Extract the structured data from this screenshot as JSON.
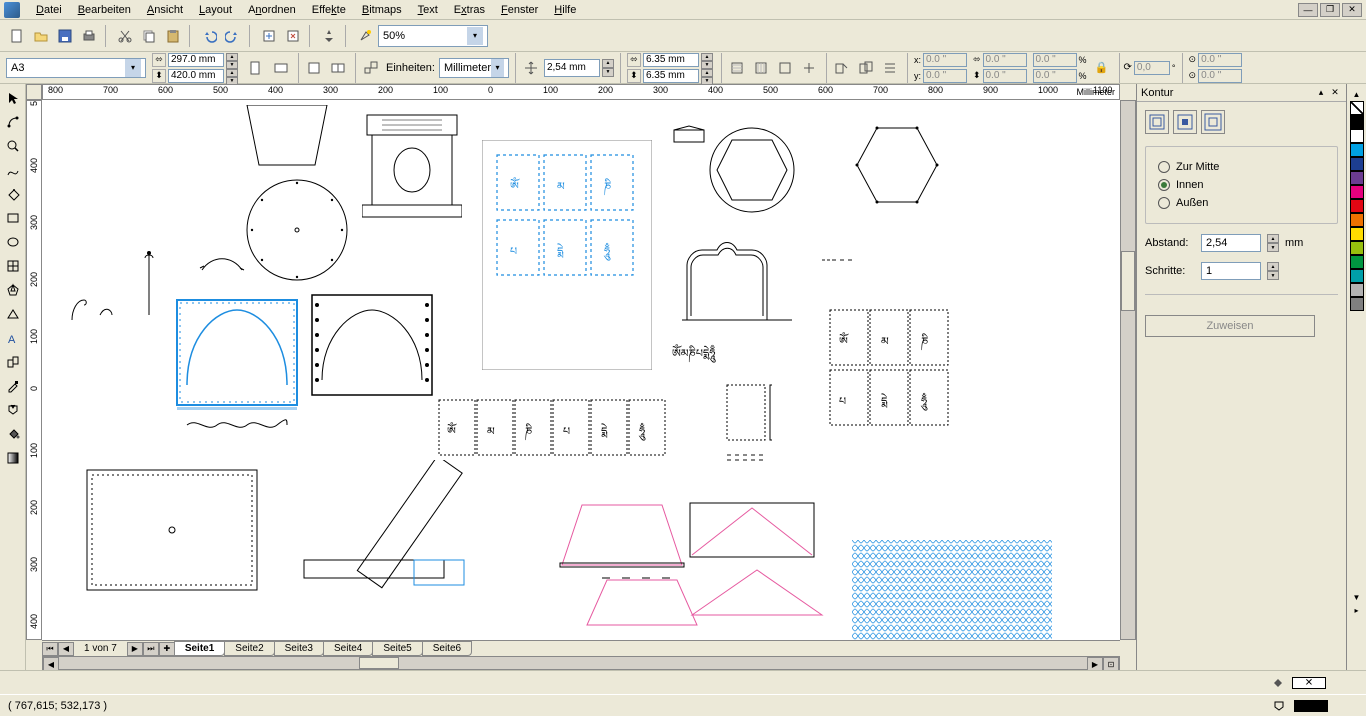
{
  "menubar": {
    "items": [
      "Datei",
      "Bearbeiten",
      "Ansicht",
      "Layout",
      "Anordnen",
      "Effekte",
      "Bitmaps",
      "Text",
      "Extras",
      "Fenster",
      "Hilfe"
    ]
  },
  "zoom": "50%",
  "page_format": "A3",
  "page_width": "297.0 mm",
  "page_height": "420.0 mm",
  "units_label": "Einheiten:",
  "units_value": "Millimeter",
  "nudge_value": "2,54 mm",
  "dup_x": "6.35 mm",
  "dup_y": "6.35 mm",
  "obj_x": "0.0 \"",
  "obj_y": "0.0 \"",
  "obj_w": "0.0 \"",
  "obj_h": "0.0 \"",
  "scale_x": "0.0 \"",
  "scale_y": "0.0 \"",
  "angle": "0,0",
  "cx": "0.0 \"",
  "cy": "0.0 \"",
  "ruler_unit": "Millimeter",
  "ruler_h": [
    "800",
    "700",
    "600",
    "500",
    "400",
    "300",
    "200",
    "100",
    "0",
    "100",
    "200",
    "300",
    "400",
    "500",
    "600",
    "700",
    "800",
    "900",
    "1000",
    "1100"
  ],
  "ruler_v": [
    "5",
    "400",
    "300",
    "200",
    "100",
    "0",
    "100",
    "200",
    "300",
    "400"
  ],
  "page_nav": "1 von 7",
  "tabs": [
    "Seite1",
    "Seite2",
    "Seite3",
    "Seite4",
    "Seite5",
    "Seite6"
  ],
  "docker": {
    "title": "Kontur",
    "opt_center": "Zur Mitte",
    "opt_inside": "Innen",
    "opt_outside": "Außen",
    "dist_label": "Abstand:",
    "dist_value": "2,54",
    "dist_unit": "mm",
    "steps_label": "Schritte:",
    "steps_value": "1",
    "apply": "Zuweisen"
  },
  "status_coords": "( 767,615; 532,173 )",
  "palette": [
    "#000000",
    "#FFFFFF",
    "#00A0E3",
    "#1D3E91",
    "#6B3C91",
    "#E6007E",
    "#E30613",
    "#EE7100",
    "#FFDD00",
    "#97BF0D",
    "#009640",
    "#009FA8",
    "#B2B2B2",
    "#808080"
  ]
}
